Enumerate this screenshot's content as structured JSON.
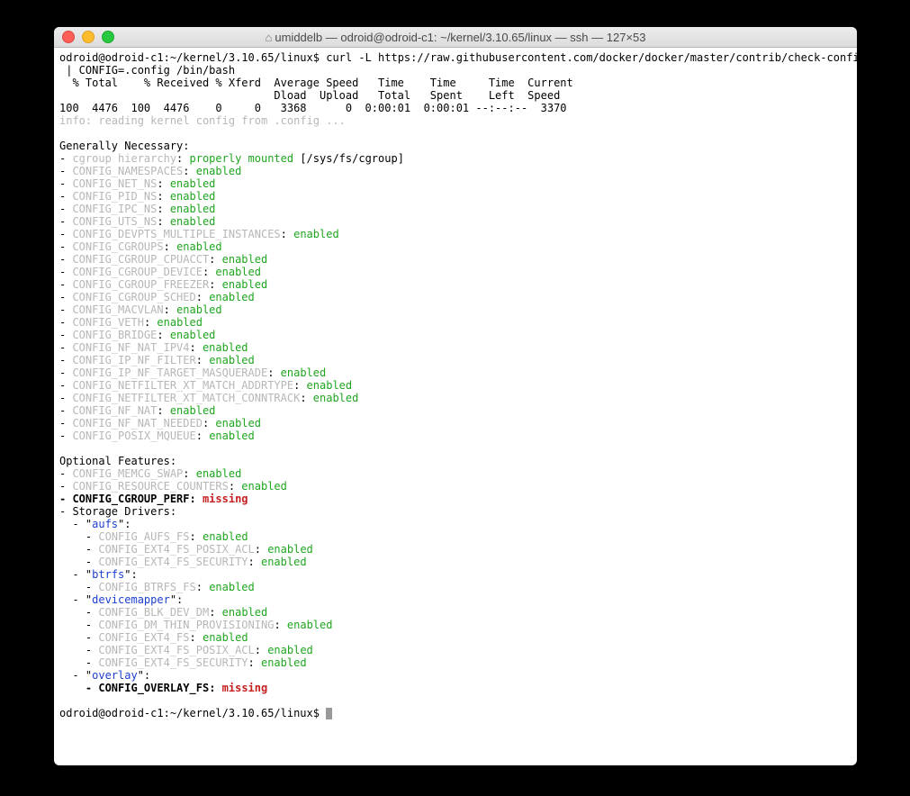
{
  "titlebar": {
    "home_glyph": "⌂",
    "title": "umiddelb — odroid@odroid-c1: ~/kernel/3.10.65/linux — ssh — 127×53"
  },
  "prompt": "odroid@odroid-c1:~/kernel/3.10.65/linux$ ",
  "cmd": "curl -L https://raw.githubusercontent.com/docker/docker/master/contrib/check-config.sh | CONFIG=.config /bin/bash",
  "curl_hdr1": "  % Total    % Received % Xferd  Average Speed   Time    Time     Time  Current",
  "curl_hdr2": "                                 Dload  Upload   Total   Spent    Left  Speed",
  "curl_row": "100  4476  100  4476    0     0   3368      0  0:00:01  0:00:01 --:--:--  3370",
  "info_line": "info: reading kernel config from .config ...",
  "gen_header": "Generally Necessary:",
  "cgroup_mount_path": " [/sys/fs/cgroup]",
  "generally": [
    {
      "bul": "- ",
      "key": "cgroup hierarchy",
      "sep": ": ",
      "val": "properly mounted",
      "tail_path": true
    },
    {
      "bul": "- ",
      "key": "CONFIG_NAMESPACES",
      "sep": ": ",
      "val": "enabled"
    },
    {
      "bul": "- ",
      "key": "CONFIG_NET_NS",
      "sep": ": ",
      "val": "enabled"
    },
    {
      "bul": "- ",
      "key": "CONFIG_PID_NS",
      "sep": ": ",
      "val": "enabled"
    },
    {
      "bul": "- ",
      "key": "CONFIG_IPC_NS",
      "sep": ": ",
      "val": "enabled"
    },
    {
      "bul": "- ",
      "key": "CONFIG_UTS_NS",
      "sep": ": ",
      "val": "enabled"
    },
    {
      "bul": "- ",
      "key": "CONFIG_DEVPTS_MULTIPLE_INSTANCES",
      "sep": ": ",
      "val": "enabled"
    },
    {
      "bul": "- ",
      "key": "CONFIG_CGROUPS",
      "sep": ": ",
      "val": "enabled"
    },
    {
      "bul": "- ",
      "key": "CONFIG_CGROUP_CPUACCT",
      "sep": ": ",
      "val": "enabled"
    },
    {
      "bul": "- ",
      "key": "CONFIG_CGROUP_DEVICE",
      "sep": ": ",
      "val": "enabled"
    },
    {
      "bul": "- ",
      "key": "CONFIG_CGROUP_FREEZER",
      "sep": ": ",
      "val": "enabled"
    },
    {
      "bul": "- ",
      "key": "CONFIG_CGROUP_SCHED",
      "sep": ": ",
      "val": "enabled"
    },
    {
      "bul": "- ",
      "key": "CONFIG_MACVLAN",
      "sep": ": ",
      "val": "enabled"
    },
    {
      "bul": "- ",
      "key": "CONFIG_VETH",
      "sep": ": ",
      "val": "enabled"
    },
    {
      "bul": "- ",
      "key": "CONFIG_BRIDGE",
      "sep": ": ",
      "val": "enabled"
    },
    {
      "bul": "- ",
      "key": "CONFIG_NF_NAT_IPV4",
      "sep": ": ",
      "val": "enabled"
    },
    {
      "bul": "- ",
      "key": "CONFIG_IP_NF_FILTER",
      "sep": ": ",
      "val": "enabled"
    },
    {
      "bul": "- ",
      "key": "CONFIG_IP_NF_TARGET_MASQUERADE",
      "sep": ": ",
      "val": "enabled"
    },
    {
      "bul": "- ",
      "key": "CONFIG_NETFILTER_XT_MATCH_ADDRTYPE",
      "sep": ": ",
      "val": "enabled"
    },
    {
      "bul": "- ",
      "key": "CONFIG_NETFILTER_XT_MATCH_CONNTRACK",
      "sep": ": ",
      "val": "enabled"
    },
    {
      "bul": "- ",
      "key": "CONFIG_NF_NAT",
      "sep": ": ",
      "val": "enabled"
    },
    {
      "bul": "- ",
      "key": "CONFIG_NF_NAT_NEEDED",
      "sep": ": ",
      "val": "enabled"
    },
    {
      "bul": "- ",
      "key": "CONFIG_POSIX_MQUEUE",
      "sep": ": ",
      "val": "enabled"
    }
  ],
  "opt_header": "Optional Features:",
  "optional_top": [
    {
      "bul": "- ",
      "key": "CONFIG_MEMCG_SWAP",
      "sep": ": ",
      "val": "enabled",
      "status": "ok"
    },
    {
      "bul": "- ",
      "key": "CONFIG_RESOURCE_COUNTERS",
      "sep": ": ",
      "val": "enabled",
      "status": "ok"
    },
    {
      "bul": "- ",
      "key": "CONFIG_CGROUP_PERF",
      "sep": ": ",
      "val": "missing",
      "status": "missing",
      "bold": true
    }
  ],
  "storage_line": "- Storage Drivers:",
  "storage": [
    {
      "name": "aufs",
      "items": [
        {
          "key": "CONFIG_AUFS_FS",
          "val": "enabled",
          "status": "ok"
        },
        {
          "key": "CONFIG_EXT4_FS_POSIX_ACL",
          "val": "enabled",
          "status": "ok"
        },
        {
          "key": "CONFIG_EXT4_FS_SECURITY",
          "val": "enabled",
          "status": "ok"
        }
      ]
    },
    {
      "name": "btrfs",
      "items": [
        {
          "key": "CONFIG_BTRFS_FS",
          "val": "enabled",
          "status": "ok"
        }
      ]
    },
    {
      "name": "devicemapper",
      "items": [
        {
          "key": "CONFIG_BLK_DEV_DM",
          "val": "enabled",
          "status": "ok"
        },
        {
          "key": "CONFIG_DM_THIN_PROVISIONING",
          "val": "enabled",
          "status": "ok"
        },
        {
          "key": "CONFIG_EXT4_FS",
          "val": "enabled",
          "status": "ok"
        },
        {
          "key": "CONFIG_EXT4_FS_POSIX_ACL",
          "val": "enabled",
          "status": "ok"
        },
        {
          "key": "CONFIG_EXT4_FS_SECURITY",
          "val": "enabled",
          "status": "ok"
        }
      ]
    },
    {
      "name": "overlay",
      "items": [
        {
          "key": "CONFIG_OVERLAY_FS",
          "val": "missing",
          "status": "missing",
          "bold": true
        }
      ]
    }
  ]
}
